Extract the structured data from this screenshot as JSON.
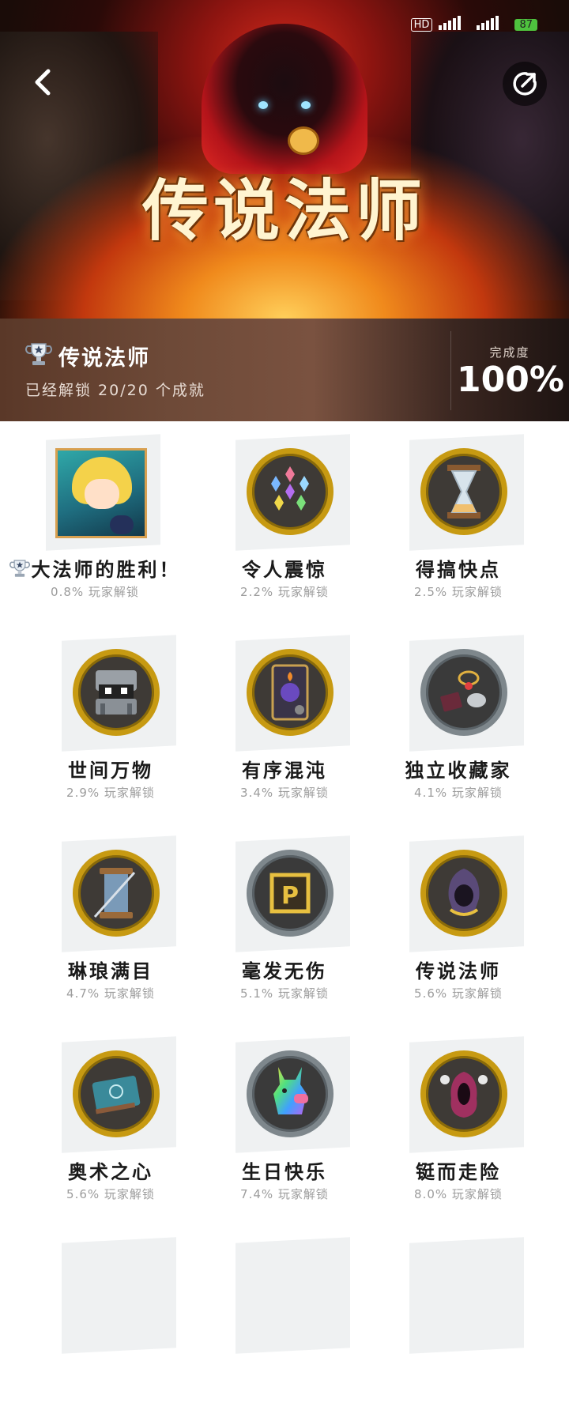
{
  "status_bar": {
    "signal": "HD",
    "battery": "87"
  },
  "hero": {
    "game_title": "传说法师"
  },
  "header": {
    "game_name": "传说法师",
    "unlocked_text": "已经解锁 20/20 个成就",
    "completion_label": "完成度",
    "completion_value": "100%"
  },
  "achievements": [
    {
      "title": "大法师的胜利！",
      "subtitle": "0.8% 玩家解锁",
      "icon": "wizard-portrait-icon"
    },
    {
      "title": "令人震惊",
      "subtitle": "2.2% 玩家解锁",
      "icon": "crystals-icon"
    },
    {
      "title": "得搞快点",
      "subtitle": "2.5% 玩家解锁",
      "icon": "hourglass-icon"
    },
    {
      "title": "世间万物",
      "subtitle": "2.9% 玩家解锁",
      "icon": "chest-mimic-icon"
    },
    {
      "title": "有序混沌",
      "subtitle": "3.4% 玩家解锁",
      "icon": "arcana-card-icon"
    },
    {
      "title": "独立收藏家",
      "subtitle": "4.1% 玩家解锁",
      "icon": "relics-icon"
    },
    {
      "title": "琳琅满目",
      "subtitle": "4.7% 玩家解锁",
      "icon": "spool-icon"
    },
    {
      "title": "毫发无伤",
      "subtitle": "5.1% 玩家解锁",
      "icon": "p-block-icon"
    },
    {
      "title": "传说法师",
      "subtitle": "5.6% 玩家解锁",
      "icon": "hooded-wizard-icon"
    },
    {
      "title": "奥术之心",
      "subtitle": "5.6% 玩家解锁",
      "icon": "spellbook-icon"
    },
    {
      "title": "生日快乐",
      "subtitle": "7.4% 玩家解锁",
      "icon": "rainbow-llama-icon"
    },
    {
      "title": "铤而走险",
      "subtitle": "8.0% 玩家解锁",
      "icon": "shadow-figure-icon"
    }
  ]
}
